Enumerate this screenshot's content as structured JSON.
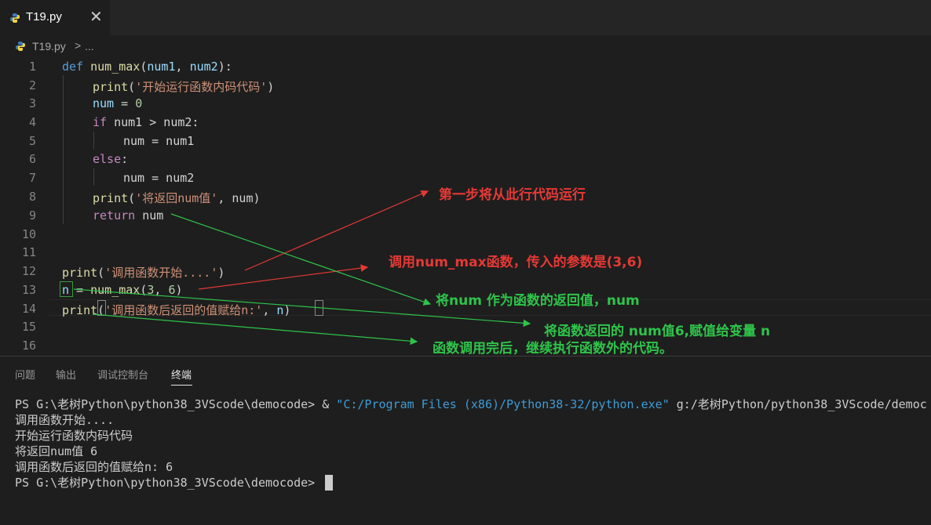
{
  "tab": {
    "label": "T19.py",
    "close": "✕"
  },
  "breadcrumb": {
    "file": "T19.py",
    "sep": ">",
    "more": "..."
  },
  "code": {
    "line_numbers": [
      "1",
      "2",
      "3",
      "4",
      "5",
      "6",
      "7",
      "8",
      "9",
      "10",
      "11",
      "12",
      "13",
      "14",
      "15",
      "16"
    ],
    "l1_kw": "def",
    "l1_fn": "num_max",
    "l1_p1": "(",
    "l1_a1": "num1",
    "l1_c": ", ",
    "l1_a2": "num2",
    "l1_p2": "):",
    "l2_fn": "print",
    "l2_p1": "(",
    "l2_str": "'开始运行函数内码代码'",
    "l2_p2": ")",
    "l3_var": "num",
    "l3_op": " = ",
    "l3_num": "0",
    "l4_kw": "if",
    "l4_rest": " num1 > num2:",
    "l5": "num = num1",
    "l6_kw": "else",
    "l6_rest": ":",
    "l7": "num = num2",
    "l8_fn": "print",
    "l8_p1": "(",
    "l8_str": "'将返回num值'",
    "l8_rest": ", num)",
    "l9_kw": "return",
    "l9_rest": " num",
    "l12_fn": "print",
    "l12_p1": "(",
    "l12_str": "'调用函数开始....'",
    "l12_p2": ")",
    "l13_var": "n",
    "l13_op": " = ",
    "l13_fn": "num_max",
    "l13_p1": "(",
    "l13_n1": "3",
    "l13_c": ", ",
    "l13_n2": "6",
    "l13_p2": ")",
    "l14_fn": "print",
    "l14_p1": "(",
    "l14_str": "'调用函数后返回的值赋给n:'",
    "l14_c": ", ",
    "l14_n": "n",
    "l14_p2": ")"
  },
  "annotations": {
    "a1": "第一步将从此行代码运行",
    "a2": "调用num_max函数，传入的参数是(3,6)",
    "a3": "将num 作为函数的返回值，num",
    "a4": "将函数返回的 num值6,赋值给变量 n",
    "a5": "函数调用完后，继续执行函数外的代码。"
  },
  "panel": {
    "tabs": [
      "问题",
      "输出",
      "调试控制台",
      "终端"
    ],
    "active_tab": "终端"
  },
  "terminal": {
    "l1_prefix": "PS G:\\老树Python\\python38_3VScode\\democode> & ",
    "l1_path": "\"C:/Program Files (x86)/Python38-32/python.exe\"",
    "l1_suffix": " g:/老树Python/python38_3VScode/democ",
    "l2": "调用函数开始....",
    "l3": "开始运行函数内码代码",
    "l4": "将返回num值 6",
    "l5": "调用函数后返回的值赋给n: 6",
    "l6": "PS G:\\老树Python\\python38_3VScode\\democode>"
  },
  "colors": {
    "red": "#e53935",
    "green": "#2ec44a",
    "background": "#1e1e1e"
  }
}
